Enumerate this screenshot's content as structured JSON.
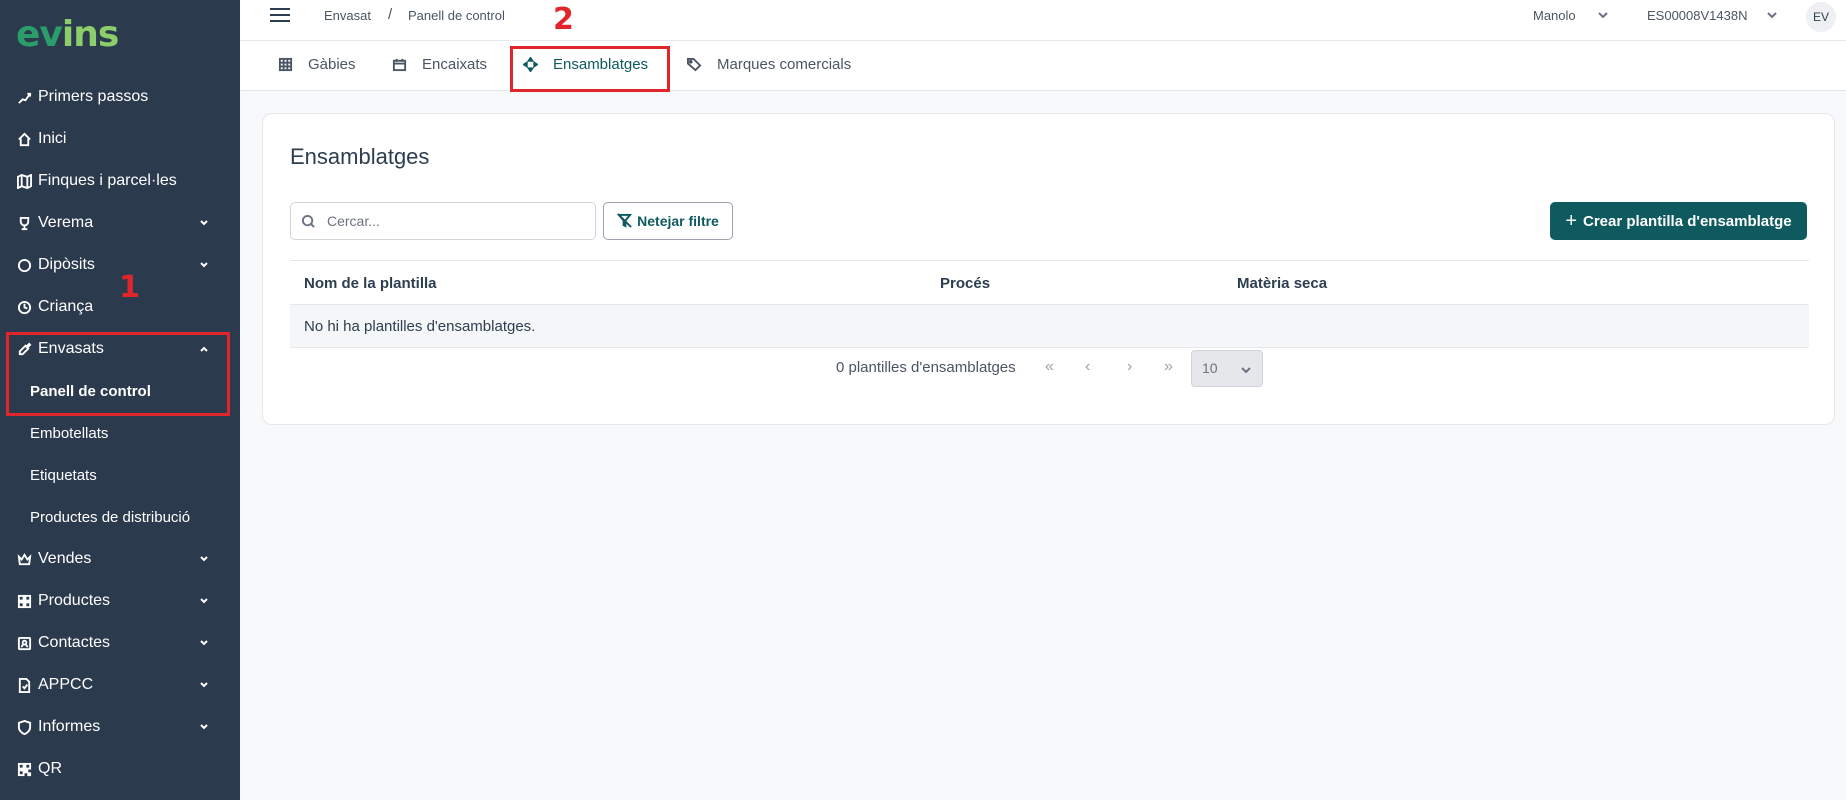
{
  "app": {
    "logo_part1": "ev",
    "logo_part2": "ins"
  },
  "sidebar": {
    "items": [
      {
        "label": "Primers passos",
        "icon": "steps-icon",
        "has_chevron": false
      },
      {
        "label": "Inici",
        "icon": "home-icon",
        "has_chevron": false
      },
      {
        "label": "Finques i parcel·les",
        "icon": "map-icon",
        "has_chevron": false
      },
      {
        "label": "Verema",
        "icon": "trophy-icon",
        "has_chevron": true
      },
      {
        "label": "Dipòsits",
        "icon": "circle-icon",
        "has_chevron": true
      },
      {
        "label": "Criança",
        "icon": "clock-icon",
        "has_chevron": false
      },
      {
        "label": "Envasats",
        "icon": "bottle-icon",
        "has_chevron": true,
        "expanded": true
      },
      {
        "label": "Vendes",
        "icon": "crown-icon",
        "has_chevron": true
      },
      {
        "label": "Productes",
        "icon": "grid-icon",
        "has_chevron": true
      },
      {
        "label": "Contactes",
        "icon": "contact-icon",
        "has_chevron": true
      },
      {
        "label": "APPCC",
        "icon": "file-check-icon",
        "has_chevron": true
      },
      {
        "label": "Informes",
        "icon": "shield-icon",
        "has_chevron": true
      },
      {
        "label": "QR",
        "icon": "qr-icon",
        "has_chevron": false
      }
    ],
    "envasats_submenu": [
      {
        "label": "Panell de control",
        "active": true
      },
      {
        "label": "Embotellats",
        "active": false
      },
      {
        "label": "Etiquetats",
        "active": false
      },
      {
        "label": "Productes de distribució",
        "active": false
      }
    ]
  },
  "annotations": {
    "marker1": "1",
    "marker2": "2",
    "color": "#e0262b"
  },
  "topbar": {
    "breadcrumb": [
      "Envasat",
      "Panell de control"
    ],
    "breadcrumb_sep": "/",
    "user": "Manolo",
    "account": "ES00008V1438N",
    "avatar": "EV"
  },
  "tabs": [
    {
      "label": "Gàbies",
      "icon": "table-icon",
      "active": false
    },
    {
      "label": "Encaixats",
      "icon": "box-icon",
      "active": false
    },
    {
      "label": "Ensamblatges",
      "icon": "move-icon",
      "active": true
    },
    {
      "label": "Marques comercials",
      "icon": "tags-icon",
      "active": false
    }
  ],
  "main": {
    "title": "Ensamblatges",
    "search_placeholder": "Cercar...",
    "clear_filter": "Netejar filtre",
    "create_button": "Crear plantilla d'ensamblatge",
    "table": {
      "columns": [
        "Nom de la plantilla",
        "Procés",
        "Matèria seca"
      ],
      "empty_message": "No hi ha plantilles d'ensamblatges."
    },
    "pagination": {
      "count_label": "0 plantilles d'ensamblatges",
      "first": "«",
      "prev": "‹",
      "next": "›",
      "last": "»",
      "page_size": "10"
    }
  },
  "colors": {
    "sidebar_bg": "#2b3a4d",
    "accent": "#0e5a5f",
    "highlight": "#e0262b"
  }
}
